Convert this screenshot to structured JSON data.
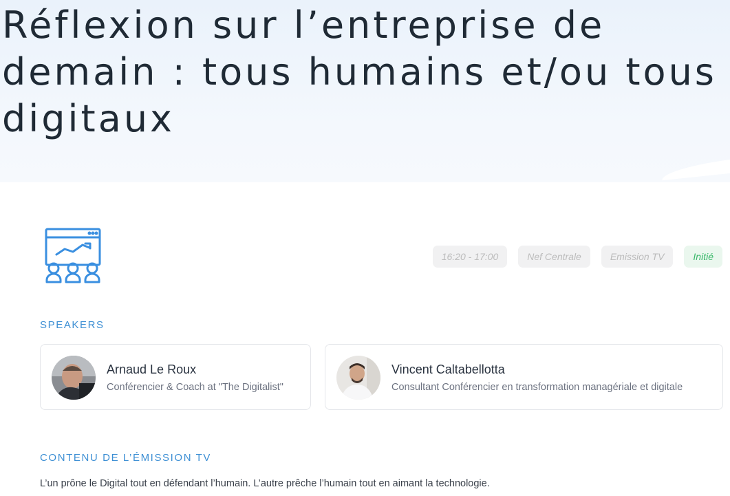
{
  "page": {
    "title": "Réflexion sur l’entreprise de demain : tous humains et/ou tous digitaux"
  },
  "session": {
    "icon": "presentation-audience-icon",
    "time": "16:20 - 17:00",
    "room": "Nef Centrale",
    "format": "Emission TV",
    "level": "Initié"
  },
  "speakers": {
    "heading": "SPEAKERS",
    "items": [
      {
        "name": "Arnaud Le Roux",
        "role": "Conférencier & Coach at \"The Digitalist\"",
        "avatar": "avatar-photo"
      },
      {
        "name": "Vincent Caltabellotta",
        "role": "Consultant Conférencier en transformation managériale et digitale",
        "avatar": "avatar-photo"
      }
    ]
  },
  "content": {
    "heading": "CONTENU DE L’ÉMISSION TV",
    "text": "L’un prône le Digital tout en défendant l’humain. L’autre prêche l’humain tout en aimant la technologie."
  },
  "colors": {
    "accent": "#3d8fd4",
    "icon": "#3a8fe0",
    "level_text": "#39b86a",
    "level_bg": "#eaf7ee",
    "tag_bg": "#f1f1f2",
    "tag_text": "#bcbcbc"
  }
}
